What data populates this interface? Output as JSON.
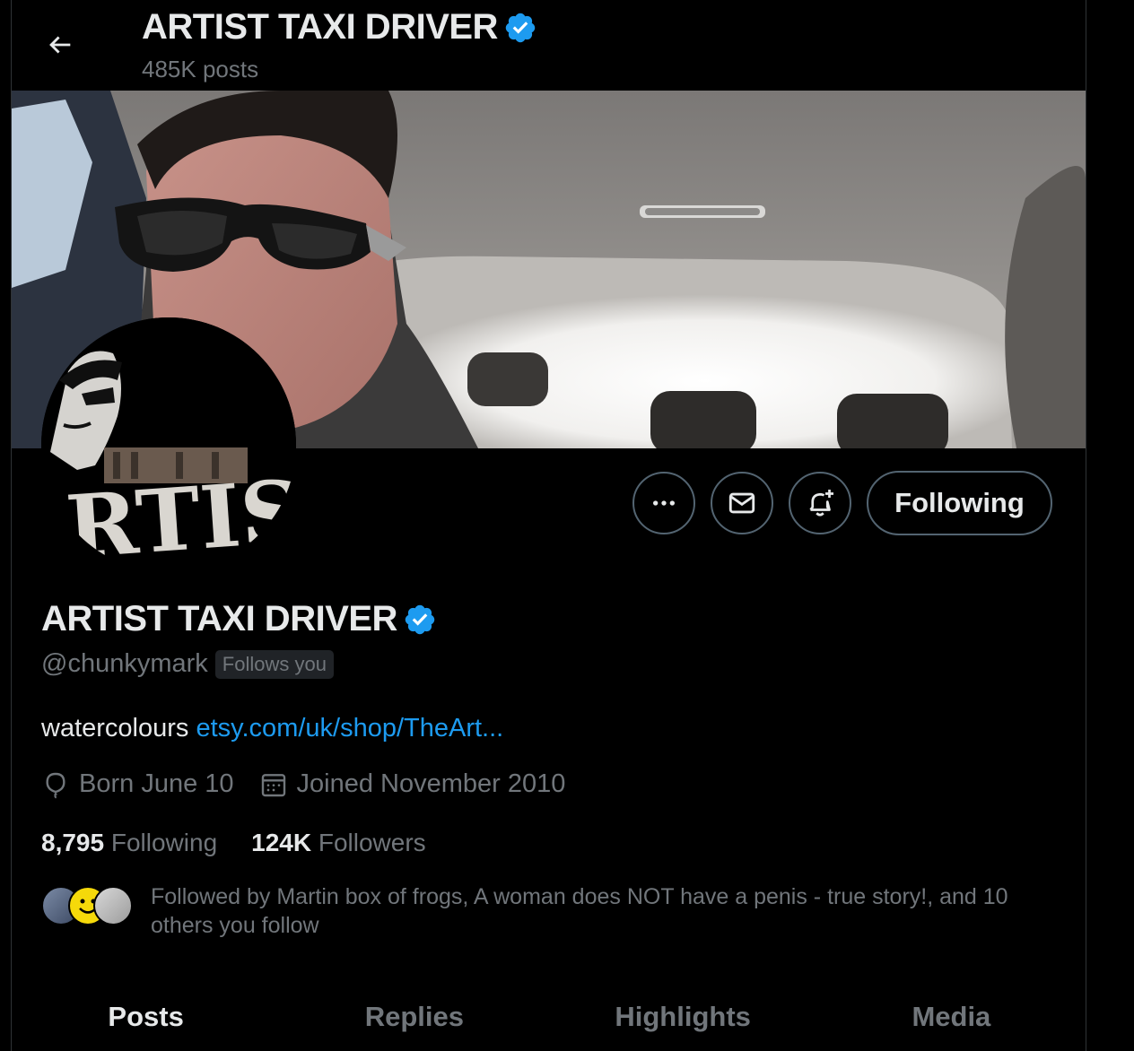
{
  "header": {
    "title": "ARTIST TAXI DRIVER",
    "posts_count": "485K posts"
  },
  "profile": {
    "avatar_text": "RTIS",
    "name": "ARTIST TAXI DRIVER",
    "handle": "@chunkymark",
    "follows_you": "Follows you",
    "bio_text": "watercolours",
    "bio_link": "etsy.com/uk/shop/TheArt...",
    "birthday": "Born June 10",
    "joined": "Joined November 2010",
    "following_count": "8,795",
    "following_label": "Following",
    "followers_count": "124K",
    "followers_label": "Followers",
    "followed_by": "Followed by Martin box of frogs, A woman does NOT have a penis - true story!, and 10 others you follow"
  },
  "actions": {
    "follow_label": "Following"
  },
  "tabs": [
    {
      "label": "Posts",
      "active": true
    },
    {
      "label": "Replies",
      "active": false
    },
    {
      "label": "Highlights",
      "active": false
    },
    {
      "label": "Media",
      "active": false
    }
  ],
  "colors": {
    "background": "#000000",
    "text_primary": "#e7e9ea",
    "text_secondary": "#71767b",
    "link": "#1d9bf0",
    "verified_badge": "#1d9bf0",
    "border": "#536471"
  },
  "icons": {
    "back": "arrow-left-icon",
    "verified": "verified-badge-icon",
    "more": "more-dots-icon",
    "message": "envelope-icon",
    "notify": "bell-plus-icon",
    "birthday": "balloon-icon",
    "calendar": "calendar-icon"
  }
}
